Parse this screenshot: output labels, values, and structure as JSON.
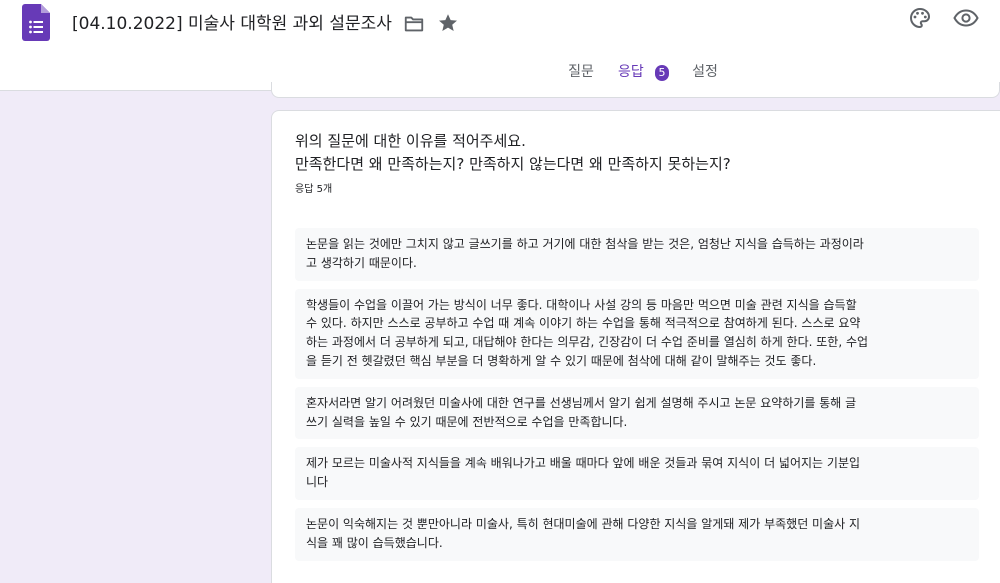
{
  "app": {
    "doc_title": "[04.10.2022] 미술사 대학원 과외 설문조사",
    "icons": {
      "logo": "google-forms-icon",
      "folder": "folder-icon",
      "star": "star-icon",
      "palette": "palette-icon",
      "preview": "eye-icon"
    },
    "colors": {
      "accent": "#673ab7",
      "page_background": "#f0ebf8",
      "response_background": "#f8f9fa"
    }
  },
  "tabs": {
    "questions": "질문",
    "responses": "응답",
    "response_count": "5",
    "settings": "설정",
    "active": "responses"
  },
  "question": {
    "line1": "위의 질문에 대한 이유를 적어주세요.",
    "line2": "만족한다면 왜 만족하는지? 만족하지 않는다면 왜 만족하지 못하는지?",
    "response_count_label": "응답 5개"
  },
  "responses": [
    "논문을 읽는 것에만 그치지 않고 글쓰기를 하고 거기에 대한 첨삭을 받는 것은, 엄청난 지식을 습득하는 과정이라\n고 생각하기 때문이다.",
    "학생들이 수업을 이끌어 가는 방식이 너무 좋다. 대학이나 사설 강의 등 마음만 먹으면 미술 관련 지식을 습득할\n수 있다. 하지만 스스로 공부하고 수업 때 계속 이야기 하는 수업을 통해 적극적으로 참여하게 된다. 스스로 요약\n하는 과정에서 더 공부하게 되고, 대답해야 한다는 의무감, 긴장감이 더 수업 준비를 열심히 하게 한다. 또한, 수업\n을 듣기 전 헷갈렸던 핵심 부분을 더 명확하게 알 수 있기 때문에 첨삭에 대해 같이 말해주는 것도 좋다.",
    "혼자서라면 알기 어려웠던 미술사에 대한 연구를 선생님께서 알기 쉽게 설명해 주시고 논문 요약하기를 통해 글\n쓰기 실력을 높일 수 있기 때문에 전반적으로 수업을 만족합니다.",
    "제가 모르는 미술사적 지식들을 계속 배워나가고 배울 때마다 앞에 배운 것들과 묶여 지식이 더 넓어지는 기분입\n니다",
    "논문이 익숙해지는 것 뿐만아니라 미술사, 특히 현대미술에 관해 다양한 지식을 알게돼 제가 부족했던 미술사 지\n식을 꽤 많이 습득했습니다."
  ]
}
